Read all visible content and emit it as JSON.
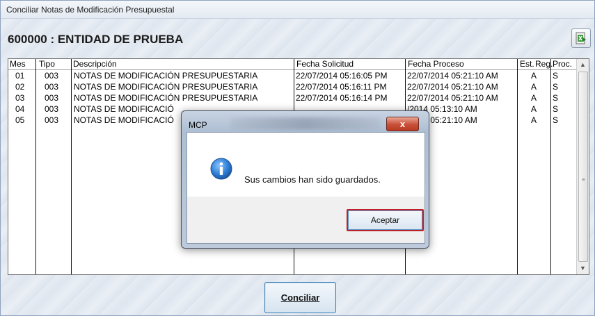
{
  "window": {
    "title": "Conciliar Notas de Modificación Presupuestal",
    "entity_title": "600000 : ENTIDAD DE PRUEBA"
  },
  "grid": {
    "columns": [
      "Mes",
      "Tipo",
      "Descripción",
      "Fecha Solicitud",
      "Fecha Proceso",
      "Est.",
      "Reg.",
      "Proc."
    ],
    "rows": [
      {
        "mes": "01",
        "tipo": "003",
        "descripcion": "NOTAS DE MODIFICACIÓN PRESUPUESTARIA",
        "fecha_solicitud": "22/07/2014 05:16:05 PM",
        "fecha_proceso": "22/07/2014 05:21:10 AM",
        "est": "A",
        "reg": "S"
      },
      {
        "mes": "02",
        "tipo": "003",
        "descripcion": "NOTAS DE MODIFICACIÓN PRESUPUESTARIA",
        "fecha_solicitud": "22/07/2014 05:16:11 PM",
        "fecha_proceso": "22/07/2014 05:21:10 AM",
        "est": "A",
        "reg": "S"
      },
      {
        "mes": "03",
        "tipo": "003",
        "descripcion": "NOTAS DE MODIFICACIÓN PRESUPUESTARIA",
        "fecha_solicitud": "22/07/2014 05:16:14 PM",
        "fecha_proceso": "22/07/2014 05:21:10 AM",
        "est": "A",
        "reg": "S"
      },
      {
        "mes": "04",
        "tipo": "003",
        "descripcion": "NOTAS DE MODIFICACIÓ",
        "fecha_solicitud": "",
        "fecha_proceso": "/2014 05:13:10 AM",
        "est": "A",
        "reg": "S"
      },
      {
        "mes": "05",
        "tipo": "003",
        "descripcion": "NOTAS DE MODIFICACIÓ",
        "fecha_solicitud": "",
        "fecha_proceso": "/2014 05:21:10 AM",
        "est": "A",
        "reg": "S"
      }
    ]
  },
  "buttons": {
    "conciliar": "Conciliar"
  },
  "dialog": {
    "title": "MCP",
    "close": "x",
    "message": "Sus cambios han sido guardados.",
    "accept": "Aceptar"
  },
  "icons": {
    "export": "excel-export-icon",
    "info": "info-icon",
    "close": "close-icon"
  },
  "colors": {
    "accent_border": "#c0202a",
    "close_button": "#c74f38",
    "info_icon": "#1f6fbf"
  }
}
